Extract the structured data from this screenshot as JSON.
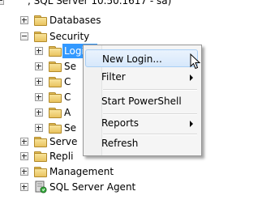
{
  "server_node": {
    "label": ", SQL Server 10.50.1617 - sa)"
  },
  "tree": {
    "databases": "Databases",
    "security": "Security",
    "logins": "Logins",
    "security_children": [
      "Se",
      "C",
      "C",
      "A",
      "Se"
    ],
    "server_objects": "Serve",
    "replication": "Repli",
    "management": "Management",
    "sql_server_agent": "SQL Server Agent"
  },
  "context_menu": {
    "items": [
      {
        "label": "New Login...",
        "submenu": false
      },
      {
        "label": "Filter",
        "submenu": true
      },
      {
        "label": "Start PowerShell",
        "submenu": false
      },
      {
        "label": "Reports",
        "submenu": true
      },
      {
        "label": "Refresh",
        "submenu": false
      }
    ]
  },
  "colors": {
    "selection": "#3399ff",
    "folder": "#e9c35f",
    "menu_highlight": "#d7e8fb"
  }
}
